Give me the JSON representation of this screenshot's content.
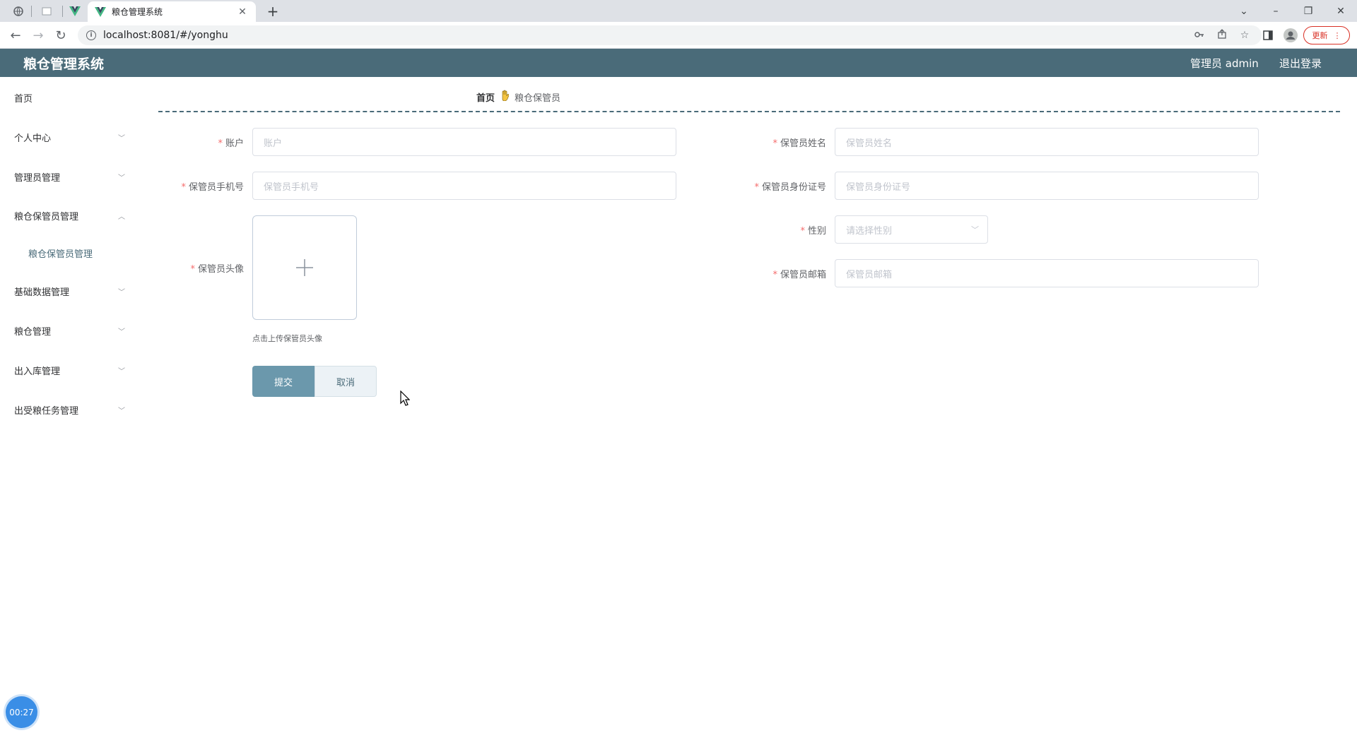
{
  "browser": {
    "tab_title": "粮仓管理系统",
    "url": "localhost:8081/#/yonghu",
    "update_label": "更新"
  },
  "header": {
    "app_title": "粮仓管理系统",
    "user_label": "管理员 admin",
    "logout_label": "退出登录"
  },
  "sidebar": {
    "items": [
      {
        "label": "首页"
      },
      {
        "label": "个人中心"
      },
      {
        "label": "管理员管理"
      },
      {
        "label": "粮仓保管员管理"
      },
      {
        "label": "粮仓保管员管理"
      },
      {
        "label": "基础数据管理"
      },
      {
        "label": "粮仓管理"
      },
      {
        "label": "出入库管理"
      },
      {
        "label": "出受粮任务管理"
      }
    ]
  },
  "breadcrumb": {
    "home": "首页",
    "current": "粮仓保管员"
  },
  "form": {
    "account": {
      "label": "账户",
      "placeholder": "账户"
    },
    "name": {
      "label": "保管员姓名",
      "placeholder": "保管员姓名"
    },
    "phone": {
      "label": "保管员手机号",
      "placeholder": "保管员手机号"
    },
    "idcard": {
      "label": "保管员身份证号",
      "placeholder": "保管员身份证号"
    },
    "avatar": {
      "label": "保管员头像",
      "hint": "点击上传保管员头像"
    },
    "gender": {
      "label": "性别",
      "placeholder": "请选择性别"
    },
    "email": {
      "label": "保管员邮箱",
      "placeholder": "保管员邮箱"
    },
    "required_mark": "*",
    "submit_label": "提交",
    "cancel_label": "取消"
  },
  "timer": "00:27",
  "colors": {
    "header_bg": "#4a6b79",
    "submit_bg": "#6b98ac",
    "required": "#f56c6c"
  }
}
